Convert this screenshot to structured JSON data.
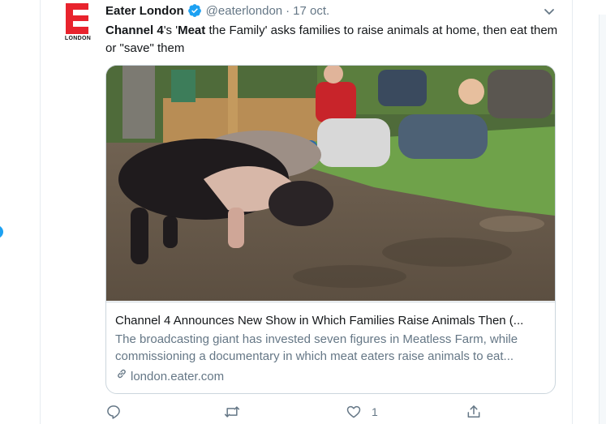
{
  "tweet": {
    "avatar_label": "LONDON",
    "author_name": "Eater London",
    "handle": "@eaterlondon",
    "separator": "·",
    "date": "17 oct.",
    "text_parts": [
      "Channel 4",
      "'s '",
      "Meat",
      " the Family' asks families to raise animals at home, then eat them or \"save\" them"
    ]
  },
  "card": {
    "title": "Channel 4 Announces New Show in Which Families Raise Animals Then (...",
    "description_lines": [
      "The broadcasting giant has invested seven figures in Meatless Farm, while",
      "commissioning a documentary in which meat eaters raise animals to eat..."
    ],
    "link": "london.eater.com"
  },
  "actions": {
    "reply_icon": "reply-icon",
    "retweet_icon": "retweet-icon",
    "like_icon": "heart-icon",
    "like_count": "1",
    "share_icon": "share-icon"
  },
  "colors": {
    "accent": "#1da1f2",
    "brand_red": "#e8232d",
    "text_primary": "#14171a",
    "text_secondary": "#657786",
    "border": "#ccd6dd"
  }
}
